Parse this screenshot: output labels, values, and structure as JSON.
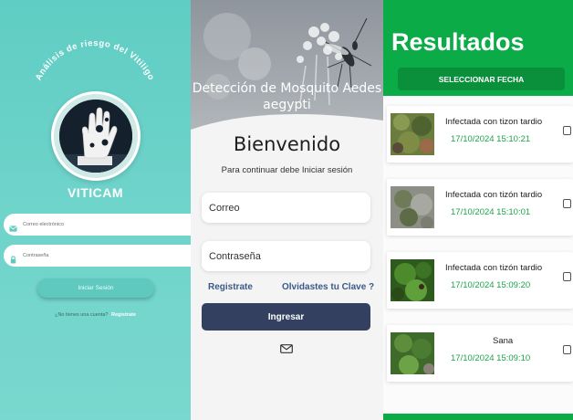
{
  "screen1": {
    "curved_title": "Análisis de riesgo del Vitiligo",
    "brand": "VITICAM",
    "email_placeholder": "Correo electrónico",
    "password_placeholder": "Contraseña",
    "login_button": "Iniciar Sesión",
    "no_account_text": "¿No tienes una cuenta?",
    "register_link": "Registrate",
    "icons": {
      "email": "mail-icon",
      "password": "lock-icon"
    },
    "colors": {
      "background": "#6ed3ca",
      "button": "#5fc9bf"
    }
  },
  "screen2": {
    "hero_title_line1": "Detección de Mosquito Aedes",
    "hero_title_line2": "aegypti",
    "welcome": "Bienvenido",
    "subtitle": "Para continuar debe Iniciar sesión",
    "email_placeholder": "Correo",
    "password_placeholder": "Contraseña",
    "register_link": "Registrate",
    "forgot_link": "Olvidastes tu Clave ?",
    "login_button": "Ingresar",
    "icons": {
      "mail": "mail-icon"
    },
    "colors": {
      "button": "#33405f",
      "link": "#3a5a8a"
    }
  },
  "screen3": {
    "title": "Resultados",
    "select_date_button": "SELECCIONAR FECHA",
    "results": [
      {
        "label": "Infectada con tizon tardio",
        "date": "17/10/2024 15:10:21"
      },
      {
        "label": "Infectada con tizón tardio",
        "date": "17/10/2024 15:10:01"
      },
      {
        "label": "Infectada con tizón tardio",
        "date": "17/10/2024 15:09:20"
      },
      {
        "label": "Sana",
        "date": "17/10/2024 15:09:10"
      }
    ],
    "colors": {
      "header": "#0bab48",
      "date": "#1aa64a"
    }
  }
}
